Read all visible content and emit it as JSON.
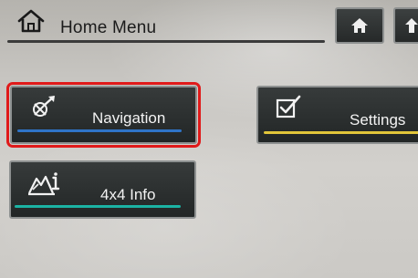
{
  "header": {
    "title": "Home Menu",
    "title_icon": "house-outline-icon",
    "buttons": [
      {
        "icon": "home-icon"
      },
      {
        "icon": "back-icon"
      }
    ]
  },
  "tiles": [
    {
      "label": "Navigation",
      "icon": "compass-arrow-icon",
      "accent": "#2f74c8",
      "selected": true
    },
    {
      "label": "Settings",
      "icon": "checkbox-icon",
      "accent": "#e2c63a",
      "selected": false
    },
    {
      "label": "4x4 Info",
      "icon": "terrain-info-icon",
      "accent": "#1bb3a4",
      "selected": false
    }
  ],
  "colors": {
    "selection_outline": "#e01a1a",
    "tile_background": "#2a2e2e",
    "screen_background": "#c8c6c2"
  }
}
